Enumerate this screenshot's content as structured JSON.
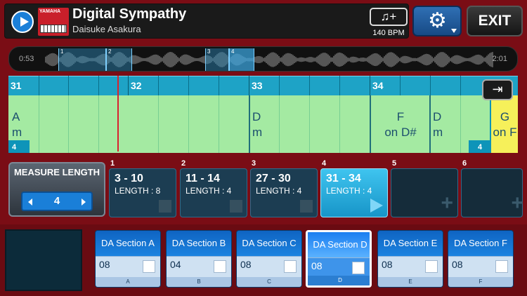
{
  "header": {
    "thumbnail_brand": "YAMAHA",
    "song_title": "Digital Sympathy",
    "artist": "Daisuke Asakura",
    "tempo_icon": "♫+",
    "bpm": "140 BPM",
    "exit_label": "EXIT"
  },
  "waveform": {
    "start_time": "0:53",
    "end_time": "2:01",
    "segments": [
      "1",
      "2",
      "3",
      "4"
    ]
  },
  "ruler": {
    "measures": [
      "31",
      "32",
      "33",
      "34"
    ]
  },
  "lane": {
    "chords": [
      {
        "root": "A",
        "quality": "m"
      },
      {
        "root": "D",
        "quality": "m"
      },
      {
        "root": "F",
        "quality": "on D#"
      },
      {
        "root": "D",
        "quality": "m"
      },
      {
        "root": "G",
        "quality": "on F"
      }
    ],
    "start_marker": "4",
    "end_marker": "4"
  },
  "measure_length": {
    "label": "MEASURE LENGTH",
    "value": "4"
  },
  "slots": [
    {
      "num": "1",
      "range": "3 - 10",
      "length": "LENGTH : 8"
    },
    {
      "num": "2",
      "range": "11 - 14",
      "length": "LENGTH : 4"
    },
    {
      "num": "3",
      "range": "27 - 30",
      "length": "LENGTH : 4"
    },
    {
      "num": "4",
      "range": "31 - 34",
      "length": "LENGTH : 4"
    },
    {
      "num": "5"
    },
    {
      "num": "6"
    }
  ],
  "sections": [
    {
      "name": "DA Section A",
      "value": "08",
      "letter": "A"
    },
    {
      "name": "DA Section B",
      "value": "04",
      "letter": "B"
    },
    {
      "name": "DA Section C",
      "value": "08",
      "letter": "C"
    },
    {
      "name": "DA Section D",
      "value": "08",
      "letter": "D"
    },
    {
      "name": "DA Section E",
      "value": "08",
      "letter": "E"
    },
    {
      "name": "DA Section F",
      "value": "08",
      "letter": "F"
    }
  ],
  "colors": {
    "accent": "#1a7fd8",
    "frame": "#7a0d15",
    "lane": "#a4eaa2",
    "highlight": "#f6f05a"
  }
}
